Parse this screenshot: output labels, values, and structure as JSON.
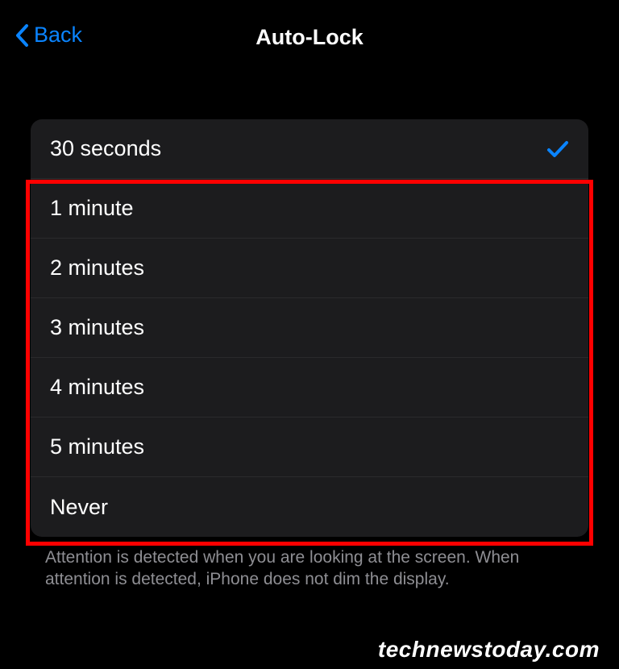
{
  "header": {
    "back_label": "Back",
    "title": "Auto-Lock"
  },
  "options": [
    {
      "label": "30 seconds",
      "selected": true
    },
    {
      "label": "1 minute",
      "selected": false
    },
    {
      "label": "2 minutes",
      "selected": false
    },
    {
      "label": "3 minutes",
      "selected": false
    },
    {
      "label": "4 minutes",
      "selected": false
    },
    {
      "label": "5 minutes",
      "selected": false
    },
    {
      "label": "Never",
      "selected": false
    }
  ],
  "footer": {
    "text": "Attention is detected when you are looking at the screen. When attention is detected, iPhone does not dim the display."
  },
  "watermark": "technewstoday.com",
  "colors": {
    "accent": "#0a84ff",
    "highlight": "#ff0000"
  }
}
